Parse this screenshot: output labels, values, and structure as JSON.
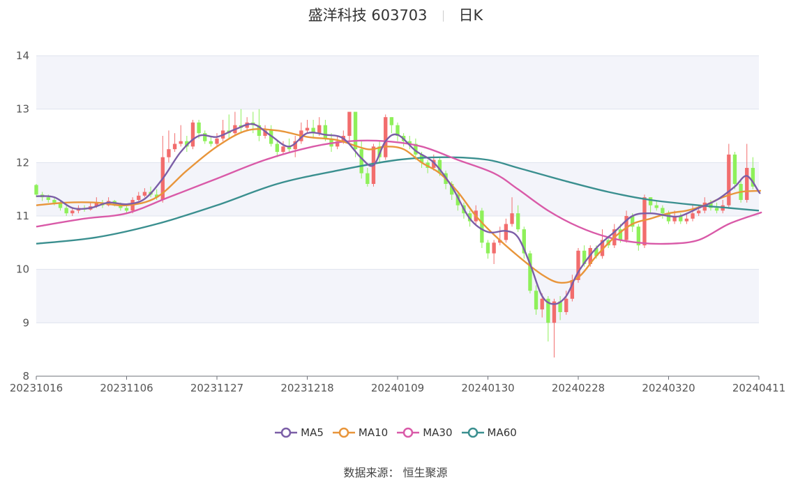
{
  "header": {
    "title": "盛洋科技 603703",
    "period": "日K"
  },
  "source": {
    "label": "数据来源：",
    "value": "恒生聚源"
  },
  "colors": {
    "up": "#f26d6d",
    "down": "#8ef05a",
    "ma5": "#7b5ea7",
    "ma10": "#e8953a",
    "ma30": "#d95aa8",
    "ma60": "#3a8f8f",
    "grid": "#dfe3ee",
    "band": "#f3f4fa"
  },
  "chart_data": {
    "type": "candlestick",
    "title": "盛洋科技 603703 日K",
    "ylim": [
      8,
      14
    ],
    "y_ticks": [
      8,
      9,
      10,
      11,
      12,
      13,
      14
    ],
    "x_tick_labels": [
      "20231016",
      "20231106",
      "20231127",
      "20231218",
      "20240109",
      "20240130",
      "20240228",
      "20240320",
      "20240411"
    ],
    "x_tick_indices": [
      0,
      15,
      30,
      45,
      60,
      75,
      90,
      105,
      120
    ],
    "num_days": 121,
    "ohlc": [
      [
        11.58,
        11.4,
        11.6,
        11.35
      ],
      [
        11.4,
        11.35,
        11.45,
        11.28
      ],
      [
        11.35,
        11.3,
        11.4,
        11.25
      ],
      [
        11.3,
        11.25,
        11.34,
        11.2
      ],
      [
        11.25,
        11.15,
        11.3,
        11.1
      ],
      [
        11.15,
        11.05,
        11.2,
        11.0
      ],
      [
        11.05,
        11.1,
        11.15,
        11.0
      ],
      [
        11.1,
        11.15,
        11.2,
        11.05
      ],
      [
        11.15,
        11.12,
        11.2,
        11.08
      ],
      [
        11.12,
        11.18,
        11.25,
        11.1
      ],
      [
        11.18,
        11.25,
        11.35,
        11.15
      ],
      [
        11.25,
        11.2,
        11.3,
        11.15
      ],
      [
        11.2,
        11.28,
        11.35,
        11.18
      ],
      [
        11.28,
        11.22,
        11.3,
        11.18
      ],
      [
        11.22,
        11.15,
        11.25,
        11.1
      ],
      [
        11.15,
        11.1,
        11.2,
        11.05
      ],
      [
        11.1,
        11.3,
        11.35,
        11.05
      ],
      [
        11.3,
        11.38,
        11.45,
        11.28
      ],
      [
        11.38,
        11.45,
        11.52,
        11.35
      ],
      [
        11.45,
        11.4,
        11.55,
        11.35
      ],
      [
        11.4,
        11.35,
        11.5,
        11.3
      ],
      [
        11.3,
        12.1,
        12.5,
        11.25
      ],
      [
        12.1,
        12.25,
        12.6,
        12.0
      ],
      [
        12.25,
        12.35,
        12.55,
        12.2
      ],
      [
        12.35,
        12.4,
        12.7,
        12.3
      ],
      [
        12.4,
        12.3,
        12.5,
        12.2
      ],
      [
        12.3,
        12.75,
        12.8,
        12.25
      ],
      [
        12.75,
        12.55,
        12.8,
        12.45
      ],
      [
        12.55,
        12.4,
        12.6,
        12.35
      ],
      [
        12.4,
        12.35,
        12.5,
        12.3
      ],
      [
        12.35,
        12.45,
        12.55,
        12.3
      ],
      [
        12.45,
        12.6,
        12.8,
        12.4
      ],
      [
        12.6,
        12.55,
        12.9,
        12.45
      ],
      [
        12.55,
        12.7,
        12.95,
        12.5
      ],
      [
        12.7,
        12.65,
        13.0,
        12.55
      ],
      [
        12.65,
        12.75,
        12.85,
        12.6
      ],
      [
        12.75,
        12.7,
        12.95,
        12.55
      ],
      [
        12.7,
        12.5,
        13.0,
        12.4
      ],
      [
        12.5,
        12.6,
        12.7,
        12.45
      ],
      [
        12.6,
        12.35,
        12.7,
        12.3
      ],
      [
        12.35,
        12.2,
        12.4,
        12.1
      ],
      [
        12.2,
        12.3,
        12.4,
        12.15
      ],
      [
        12.3,
        12.25,
        12.45,
        12.2
      ],
      [
        12.25,
        12.4,
        12.5,
        12.1
      ],
      [
        12.4,
        12.6,
        12.75,
        12.35
      ],
      [
        12.6,
        12.65,
        12.8,
        12.55
      ],
      [
        12.65,
        12.55,
        12.8,
        12.45
      ],
      [
        12.55,
        12.7,
        12.85,
        12.5
      ],
      [
        12.7,
        12.45,
        12.8,
        12.4
      ],
      [
        12.45,
        12.3,
        12.55,
        12.2
      ],
      [
        12.3,
        12.4,
        12.5,
        12.25
      ],
      [
        12.4,
        12.5,
        12.6,
        12.35
      ],
      [
        12.5,
        12.95,
        12.95,
        12.35
      ],
      [
        12.95,
        12.25,
        12.95,
        12.1
      ],
      [
        12.25,
        11.8,
        12.4,
        11.7
      ],
      [
        11.8,
        11.6,
        11.9,
        11.55
      ],
      [
        11.6,
        12.3,
        12.35,
        11.55
      ],
      [
        12.3,
        12.1,
        12.4,
        12.0
      ],
      [
        12.1,
        12.85,
        12.9,
        12.05
      ],
      [
        12.85,
        12.7,
        12.85,
        12.55
      ],
      [
        12.7,
        12.5,
        12.75,
        12.4
      ],
      [
        12.5,
        12.4,
        12.55,
        12.3
      ],
      [
        12.4,
        12.35,
        12.5,
        12.25
      ],
      [
        12.35,
        12.15,
        12.45,
        12.05
      ],
      [
        12.15,
        12.0,
        12.2,
        11.9
      ],
      [
        12.0,
        11.9,
        12.05,
        11.8
      ],
      [
        11.9,
        12.05,
        12.15,
        11.85
      ],
      [
        12.05,
        11.8,
        12.1,
        11.75
      ],
      [
        11.8,
        11.6,
        11.85,
        11.5
      ],
      [
        11.6,
        11.4,
        11.65,
        11.3
      ],
      [
        11.4,
        11.2,
        11.45,
        11.1
      ],
      [
        11.2,
        11.05,
        11.25,
        10.95
      ],
      [
        11.05,
        10.9,
        11.1,
        10.8
      ],
      [
        10.9,
        11.1,
        11.2,
        10.85
      ],
      [
        11.1,
        10.5,
        11.15,
        10.4
      ],
      [
        10.5,
        10.3,
        10.55,
        10.2
      ],
      [
        10.3,
        10.5,
        10.55,
        10.1
      ],
      [
        10.5,
        10.55,
        10.8,
        10.45
      ],
      [
        10.55,
        10.85,
        10.95,
        10.5
      ],
      [
        10.85,
        11.05,
        11.35,
        10.8
      ],
      [
        11.05,
        10.75,
        11.2,
        10.7
      ],
      [
        10.75,
        10.3,
        10.8,
        10.2
      ],
      [
        10.3,
        9.6,
        10.35,
        9.55
      ],
      [
        9.6,
        9.25,
        9.7,
        9.15
      ],
      [
        9.25,
        9.45,
        9.55,
        9.1
      ],
      [
        9.45,
        9.0,
        9.5,
        8.65
      ],
      [
        9.0,
        9.4,
        9.45,
        8.35
      ],
      [
        9.4,
        9.2,
        9.5,
        9.05
      ],
      [
        9.2,
        9.45,
        9.6,
        9.15
      ],
      [
        9.45,
        9.8,
        9.9,
        9.4
      ],
      [
        9.8,
        10.35,
        10.4,
        9.75
      ],
      [
        10.35,
        10.1,
        10.45,
        10.05
      ],
      [
        10.1,
        10.4,
        10.45,
        10.05
      ],
      [
        10.4,
        10.25,
        10.45,
        10.2
      ],
      [
        10.25,
        10.55,
        10.75,
        10.2
      ],
      [
        10.55,
        10.45,
        10.6,
        10.4
      ],
      [
        10.45,
        10.75,
        10.85,
        10.4
      ],
      [
        10.75,
        10.55,
        10.85,
        10.5
      ],
      [
        10.55,
        11.0,
        11.1,
        10.5
      ],
      [
        11.0,
        10.8,
        11.05,
        10.7
      ],
      [
        10.8,
        10.45,
        10.85,
        10.35
      ],
      [
        10.45,
        11.35,
        11.4,
        10.4
      ],
      [
        11.35,
        11.2,
        11.35,
        11.05
      ],
      [
        11.2,
        11.15,
        11.3,
        11.1
      ],
      [
        11.15,
        11.05,
        11.2,
        10.95
      ],
      [
        11.05,
        10.9,
        11.1,
        10.85
      ],
      [
        10.9,
        11.0,
        11.1,
        10.85
      ],
      [
        11.0,
        10.9,
        11.05,
        10.85
      ],
      [
        10.9,
        10.95,
        11.05,
        10.85
      ],
      [
        10.95,
        11.05,
        11.2,
        10.9
      ],
      [
        11.05,
        11.1,
        11.2,
        11.0
      ],
      [
        11.1,
        11.25,
        11.35,
        11.05
      ],
      [
        11.25,
        11.15,
        11.3,
        11.1
      ],
      [
        11.15,
        11.1,
        11.25,
        11.05
      ],
      [
        11.1,
        11.2,
        11.3,
        11.05
      ],
      [
        11.2,
        12.15,
        12.35,
        11.15
      ],
      [
        12.15,
        11.6,
        12.2,
        11.5
      ],
      [
        11.6,
        11.3,
        11.7,
        11.25
      ],
      [
        11.3,
        11.9,
        12.35,
        11.25
      ],
      [
        11.9,
        11.55,
        12.1,
        11.5
      ]
    ],
    "ma5": [
      [
        0,
        11.37
      ],
      [
        3,
        11.35
      ],
      [
        6,
        11.15
      ],
      [
        9,
        11.15
      ],
      [
        12,
        11.25
      ],
      [
        15,
        11.22
      ],
      [
        18,
        11.32
      ],
      [
        21,
        11.7
      ],
      [
        24,
        12.2
      ],
      [
        27,
        12.5
      ],
      [
        30,
        12.48
      ],
      [
        33,
        12.62
      ],
      [
        36,
        12.72
      ],
      [
        39,
        12.5
      ],
      [
        42,
        12.3
      ],
      [
        45,
        12.55
      ],
      [
        48,
        12.52
      ],
      [
        51,
        12.45
      ],
      [
        54,
        12.08
      ],
      [
        56,
        11.95
      ],
      [
        58,
        12.4
      ],
      [
        60,
        12.52
      ],
      [
        63,
        12.22
      ],
      [
        66,
        12.0
      ],
      [
        69,
        11.55
      ],
      [
        72,
        10.95
      ],
      [
        75,
        10.7
      ],
      [
        78,
        10.72
      ],
      [
        80,
        10.6
      ],
      [
        82,
        10.1
      ],
      [
        84,
        9.5
      ],
      [
        86,
        9.35
      ],
      [
        88,
        9.5
      ],
      [
        90,
        9.95
      ],
      [
        93,
        10.4
      ],
      [
        96,
        10.7
      ],
      [
        99,
        11.0
      ],
      [
        102,
        11.05
      ],
      [
        105,
        11.0
      ],
      [
        107,
        11.0
      ],
      [
        110,
        11.15
      ],
      [
        113,
        11.3
      ],
      [
        116,
        11.55
      ],
      [
        118,
        11.75
      ],
      [
        120,
        11.45
      ],
      [
        121,
        11.45
      ]
    ],
    "ma10": [
      [
        0,
        11.2
      ],
      [
        5,
        11.25
      ],
      [
        10,
        11.25
      ],
      [
        15,
        11.2
      ],
      [
        20,
        11.35
      ],
      [
        25,
        11.85
      ],
      [
        30,
        12.3
      ],
      [
        35,
        12.6
      ],
      [
        40,
        12.6
      ],
      [
        45,
        12.48
      ],
      [
        50,
        12.42
      ],
      [
        55,
        12.25
      ],
      [
        58,
        12.3
      ],
      [
        61,
        12.25
      ],
      [
        64,
        12.0
      ],
      [
        67,
        11.8
      ],
      [
        70,
        11.45
      ],
      [
        73,
        11.0
      ],
      [
        76,
        10.65
      ],
      [
        80,
        10.25
      ],
      [
        84,
        9.9
      ],
      [
        87,
        9.75
      ],
      [
        90,
        9.85
      ],
      [
        93,
        10.25
      ],
      [
        96,
        10.6
      ],
      [
        99,
        10.85
      ],
      [
        102,
        10.95
      ],
      [
        105,
        11.05
      ],
      [
        108,
        11.1
      ],
      [
        111,
        11.2
      ],
      [
        114,
        11.35
      ],
      [
        117,
        11.45
      ],
      [
        120,
        11.47
      ],
      [
        121,
        11.47
      ]
    ],
    "ma30": [
      [
        0,
        10.8
      ],
      [
        8,
        10.95
      ],
      [
        15,
        11.05
      ],
      [
        22,
        11.35
      ],
      [
        30,
        11.7
      ],
      [
        38,
        12.05
      ],
      [
        46,
        12.3
      ],
      [
        52,
        12.4
      ],
      [
        58,
        12.4
      ],
      [
        64,
        12.3
      ],
      [
        70,
        12.05
      ],
      [
        76,
        11.8
      ],
      [
        80,
        11.5
      ],
      [
        85,
        11.1
      ],
      [
        90,
        10.8
      ],
      [
        95,
        10.6
      ],
      [
        100,
        10.5
      ],
      [
        105,
        10.48
      ],
      [
        110,
        10.55
      ],
      [
        115,
        10.85
      ],
      [
        120,
        11.05
      ],
      [
        121,
        11.05
      ]
    ],
    "ma60": [
      [
        0,
        10.48
      ],
      [
        10,
        10.6
      ],
      [
        20,
        10.85
      ],
      [
        30,
        11.2
      ],
      [
        40,
        11.6
      ],
      [
        50,
        11.85
      ],
      [
        60,
        12.05
      ],
      [
        68,
        12.1
      ],
      [
        75,
        12.05
      ],
      [
        80,
        11.9
      ],
      [
        88,
        11.65
      ],
      [
        95,
        11.45
      ],
      [
        102,
        11.3
      ],
      [
        110,
        11.2
      ],
      [
        115,
        11.15
      ],
      [
        121,
        11.1
      ]
    ],
    "legend": [
      "MA5",
      "MA10",
      "MA30",
      "MA60"
    ],
    "grid": true,
    "legend_position": "bottom"
  }
}
